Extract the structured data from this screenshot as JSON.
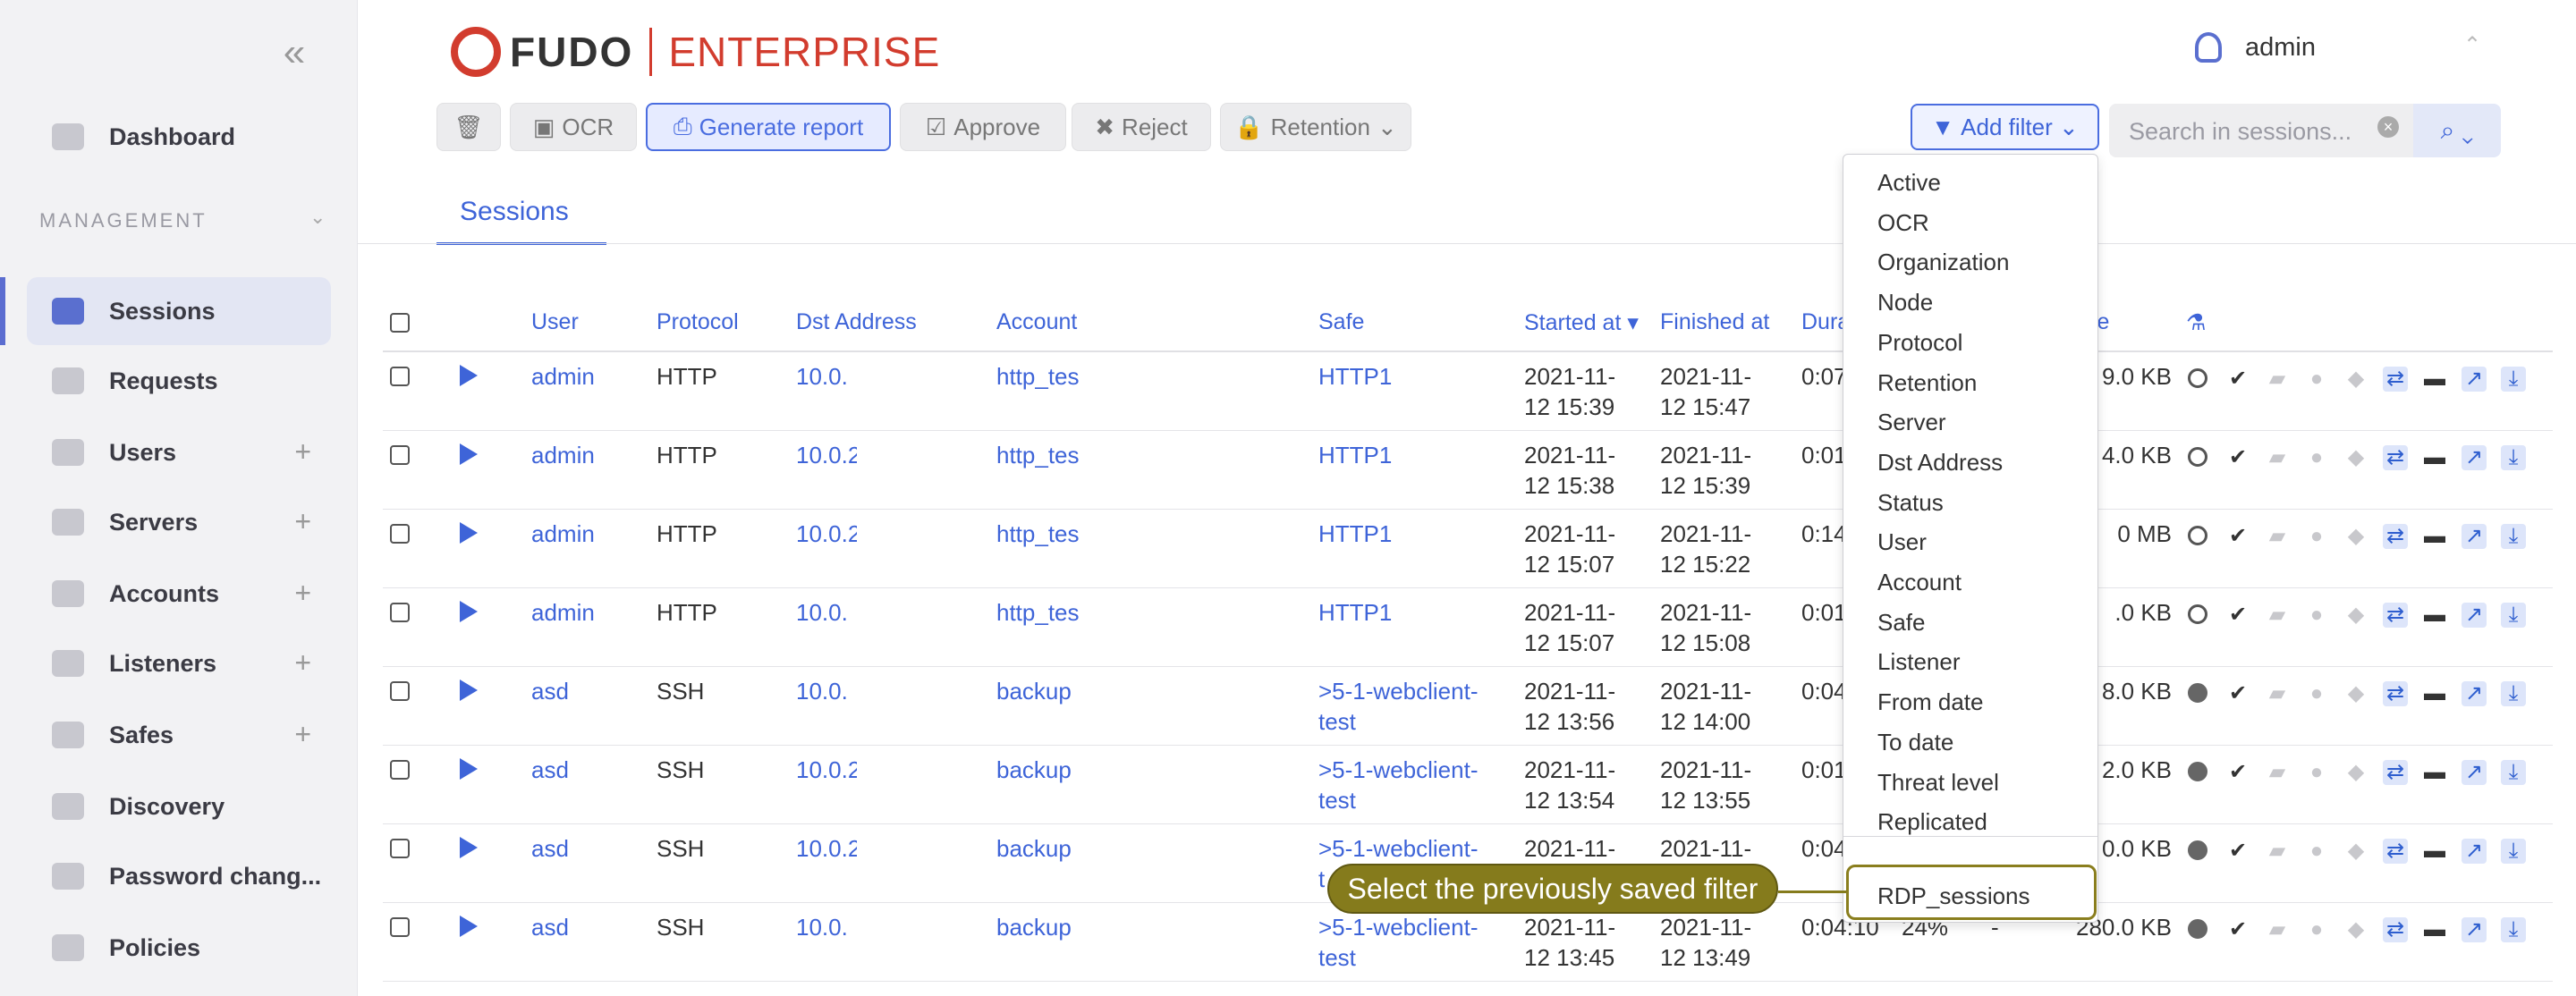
{
  "sidebar": {
    "dashboard": "Dashboard",
    "section": "MANAGEMENT",
    "items": [
      "Sessions",
      "Requests",
      "Users",
      "Servers",
      "Accounts",
      "Listeners",
      "Safes",
      "Discovery",
      "Password chang...",
      "Policies"
    ]
  },
  "brand": {
    "fudo": "FUDO",
    "enterprise": "ENTERPRISE"
  },
  "user": {
    "name": "admin"
  },
  "toolbar": {
    "ocr": "OCR",
    "generate": "Generate report",
    "approve": "Approve",
    "reject": "Reject",
    "retention": "Retention"
  },
  "filter": {
    "add": "Add filter",
    "search_placeholder": "Search in sessions..."
  },
  "tab": "Sessions",
  "columns": {
    "user": "User",
    "protocol": "Protocol",
    "dst": "Dst Address",
    "account": "Account",
    "safe": "Safe",
    "started": "Started at",
    "finished": "Finished at",
    "duration": "Dura",
    "size": "ze"
  },
  "rows": [
    {
      "user": "admin",
      "protocol": "HTTP",
      "dst": "10.0.",
      "account": "http_tes",
      "safe": "HTTP1",
      "s1": "2021-11-",
      "s2": "12 15:39",
      "f1": "2021-11-",
      "f2": "12 15:47",
      "dur": "0:07",
      "size": "9.0 KB"
    },
    {
      "user": "admin",
      "protocol": "HTTP",
      "dst": "10.0.2",
      "account": "http_tes",
      "safe": "HTTP1",
      "s1": "2021-11-",
      "s2": "12 15:38",
      "f1": "2021-11-",
      "f2": "12 15:39",
      "dur": "0:01",
      "size": "4.0 KB"
    },
    {
      "user": "admin",
      "protocol": "HTTP",
      "dst": "10.0.2",
      "account": "http_tes",
      "safe": "HTTP1",
      "s1": "2021-11-",
      "s2": "12 15:07",
      "f1": "2021-11-",
      "f2": "12 15:22",
      "dur": "0:14",
      "size": "0 MB"
    },
    {
      "user": "admin",
      "protocol": "HTTP",
      "dst": "10.0.",
      "account": "http_tes",
      "safe": "HTTP1",
      "s1": "2021-11-",
      "s2": "12 15:07",
      "f1": "2021-11-",
      "f2": "12 15:08",
      "dur": "0:01",
      "size": ".0 KB"
    },
    {
      "user": "asd",
      "protocol": "SSH",
      "dst": "10.0.",
      "account": "backup",
      "safe": ">5-1-webclient-",
      "safe2": "test",
      "s1": "2021-11-",
      "s2": "12 13:56",
      "f1": "2021-11-",
      "f2": "12 14:00",
      "dur": "0:04",
      "size": "8.0 KB"
    },
    {
      "user": "asd",
      "protocol": "SSH",
      "dst": "10.0.2",
      "account": "backup",
      "safe": ">5-1-webclient-",
      "safe2": "test",
      "s1": "2021-11-",
      "s2": "12 13:54",
      "f1": "2021-11-",
      "f2": "12 13:55",
      "dur": "0:01",
      "size": "2.0 KB"
    },
    {
      "user": "asd",
      "protocol": "SSH",
      "dst": "10.0.2",
      "account": "backup",
      "safe": ">5-1-webclient-",
      "safe2": "t",
      "s1": "2021-11-",
      "s2": "",
      "f1": "2021-11-",
      "f2": "",
      "dur": "0:04",
      "size": "0.0 KB"
    },
    {
      "user": "asd",
      "protocol": "SSH",
      "dst": "10.0.",
      "account": "backup",
      "safe": ">5-1-webclient-",
      "safe2": "test",
      "s1": "2021-11-",
      "s2": "12 13:45",
      "f1": "2021-11-",
      "f2": "12 13:49",
      "dur": "0:04:10",
      "pct": "24%",
      "dash": "-",
      "size": "280.0 KB"
    }
  ],
  "dropdown": [
    "Active",
    "OCR",
    "Organization",
    "Node",
    "Protocol",
    "Retention",
    "Server",
    "Dst Address",
    "Status",
    "User",
    "Account",
    "Safe",
    "Listener",
    "From date",
    "To date",
    "Threat level",
    "Replicated"
  ],
  "saved": "RDP_sessions",
  "callout": "Select the previously saved filter"
}
